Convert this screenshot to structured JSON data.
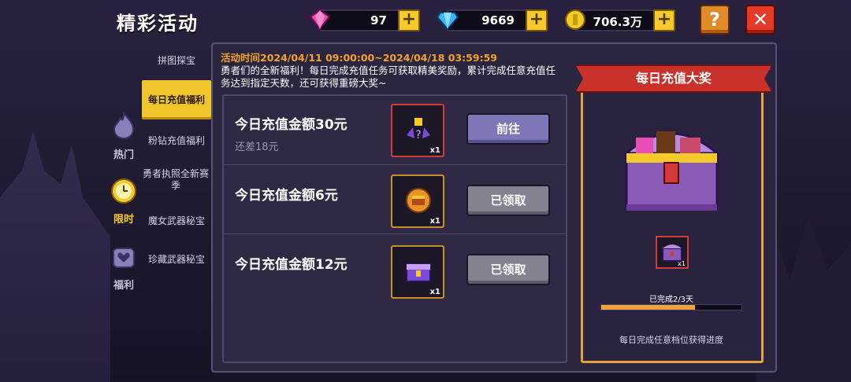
{
  "header": {
    "title": "精彩活动"
  },
  "currencies": [
    {
      "name": "pink-gem-icon",
      "value": "97"
    },
    {
      "name": "blue-diamond-icon",
      "value": "9669"
    },
    {
      "name": "gold-coin-icon",
      "value": "706.3万"
    }
  ],
  "buttons": {
    "help": "?",
    "close": "✕",
    "plus": "+"
  },
  "categories": [
    {
      "icon": "fire-icon",
      "label": "热门"
    },
    {
      "icon": "clock-icon",
      "label": "限时",
      "active": true
    },
    {
      "icon": "heart-bag-icon",
      "label": "福利"
    }
  ],
  "submenu": [
    {
      "label": "拼图探宝"
    },
    {
      "label": "每日充值福利",
      "active": true
    },
    {
      "label": "粉钻充值福利"
    },
    {
      "label": "勇者执照全新赛季"
    },
    {
      "label": "魔女武器秘宝"
    },
    {
      "label": "珍藏武器秘宝"
    }
  ],
  "event": {
    "time": "活动时间2024/04/11 09:00:00~2024/04/18 03:59:59",
    "description": "勇者们的全新福利！每日完成充值任务可获取精美奖励，累计完成任意充值任务达到指定天数，还可获得重磅大奖~"
  },
  "tasks": [
    {
      "title": "今日充值金额30元",
      "subtitle": "还差18元",
      "qty": "x1",
      "button": "前往",
      "state": "go"
    },
    {
      "title": "今日充值金额6元",
      "subtitle": "",
      "qty": "x1",
      "button": "已领取",
      "state": "done"
    },
    {
      "title": "今日充值金额12元",
      "subtitle": "",
      "qty": "x1",
      "button": "已领取",
      "state": "done"
    }
  ],
  "prize": {
    "banner": "每日充值大奖",
    "item_qty": "x1",
    "progress_label": "已完成2/3天",
    "progress_fraction": 0.667,
    "hint": "每日完成任意档位获得进度"
  },
  "colors": {
    "accent_yellow": "#f1c62c",
    "time_orange": "#f4a32a",
    "banner_red": "#c8322a",
    "progress_orange": "#f2a23a"
  }
}
